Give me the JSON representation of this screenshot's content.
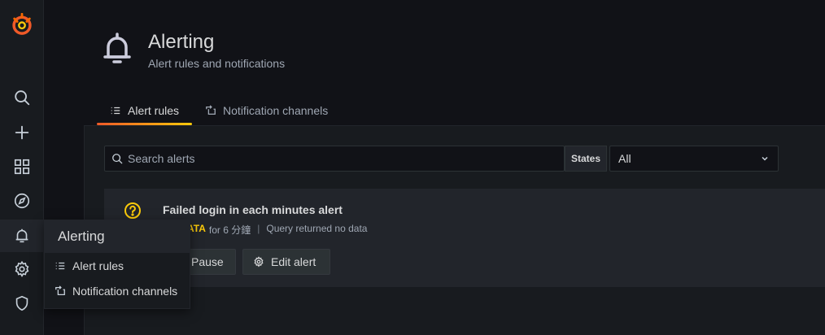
{
  "colors": {
    "brand": "#f05a28",
    "warning": "#fbca0a",
    "background": "#111217",
    "panel": "#181b1f"
  },
  "sidebar": {
    "items": [
      {
        "icon": "grafana-logo-icon"
      },
      {
        "icon": "search-icon"
      },
      {
        "icon": "plus-icon"
      },
      {
        "icon": "dashboards-grid-icon"
      },
      {
        "icon": "compass-icon"
      },
      {
        "icon": "bell-icon",
        "active": true
      },
      {
        "icon": "gear-icon"
      },
      {
        "icon": "shield-icon"
      }
    ]
  },
  "header": {
    "title": "Alerting",
    "subtitle": "Alert rules and notifications",
    "icon": "bell-icon"
  },
  "tabs": [
    {
      "label": "Alert rules",
      "icon": "list-icon",
      "active": true
    },
    {
      "label": "Notification channels",
      "icon": "channel-icon",
      "active": false
    }
  ],
  "filters": {
    "search_placeholder": "Search alerts",
    "states_label": "States",
    "states_value": "All"
  },
  "alert": {
    "title": "Failed login in each minutes alert",
    "state": "NO DATA",
    "for_text": "for 6 分鐘",
    "separator": "|",
    "info": "Query returned no data",
    "pause_label": "Pause",
    "edit_label": "Edit alert"
  },
  "flyout": {
    "title": "Alerting",
    "items": [
      {
        "label": "Alert rules",
        "icon": "list-icon"
      },
      {
        "label": "Notification channels",
        "icon": "channel-icon"
      }
    ]
  }
}
